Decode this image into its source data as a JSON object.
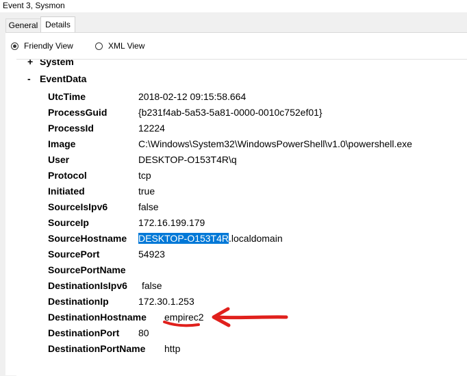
{
  "window": {
    "title": "Event 3, Sysmon"
  },
  "tabs": [
    {
      "label": "General"
    },
    {
      "label": "Details"
    }
  ],
  "view_options": {
    "friendly": "Friendly View",
    "xml": "XML View"
  },
  "sections": {
    "system": {
      "toggle": "+",
      "label": "System"
    },
    "eventdata": {
      "toggle": "-",
      "label": "EventData"
    }
  },
  "fields": [
    {
      "key": "UtcTime",
      "value": "2018-02-12 09:15:58.664"
    },
    {
      "key": "ProcessGuid",
      "value": "{b231f4ab-5a53-5a81-0000-0010c752ef01}"
    },
    {
      "key": "ProcessId",
      "value": "12224"
    },
    {
      "key": "Image",
      "value": "C:\\Windows\\System32\\WindowsPowerShell\\v1.0\\powershell.exe"
    },
    {
      "key": "User",
      "value": "DESKTOP-O153T4R\\q"
    },
    {
      "key": "Protocol",
      "value": "tcp"
    },
    {
      "key": "Initiated",
      "value": "true"
    },
    {
      "key": "SourceIsIpv6",
      "value": "false"
    },
    {
      "key": "SourceIp",
      "value": "172.16.199.179"
    },
    {
      "key": "SourceHostname",
      "value_selected": "DESKTOP-O153T4R",
      "value_rest": ".localdomain"
    },
    {
      "key": "SourcePort",
      "value": "54923"
    },
    {
      "key": "SourcePortName",
      "value": ""
    },
    {
      "key": "DestinationIsIpv6",
      "value": "false"
    },
    {
      "key": "DestinationIp",
      "value": "172.30.1.253"
    },
    {
      "key": "DestinationHostname",
      "value": "empirec2"
    },
    {
      "key": "DestinationPort",
      "value": "80"
    },
    {
      "key": "DestinationPortName",
      "value": "http"
    }
  ],
  "colors": {
    "selection": "#0078d7",
    "annotation": "#e0201c"
  }
}
